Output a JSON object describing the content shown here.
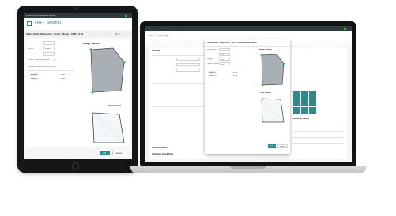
{
  "tablet": {
    "window_title": "Dynamics 365 Business Central",
    "header_title": "VRF - Setenig",
    "page_title": "Sales Order Shape Fen - Front - Rome - VSIP - 3.45",
    "section_title": "Shape Sketch",
    "section_sub": "CAD Model",
    "table_header": "Shape Dimensions and Bend",
    "fields": [
      {
        "label": "Shape No.",
        "value": "10"
      },
      {
        "label": "Width",
        "value": "3.400"
      },
      {
        "label": "Height",
        "value": "3.5"
      },
      {
        "label": "Sheet Thickness",
        "value": "3 mm"
      }
    ],
    "table_rows": [
      {
        "name": "Width 1",
        "value": "3.40"
      },
      {
        "name": "Height 1",
        "value": "3.50"
      }
    ],
    "footer_ok": "OK",
    "footer_cancel": "Cancel"
  },
  "laptop": {
    "window_title": "Dynamics 365 Business Central",
    "header_title": "VRF - Setenig",
    "dialog_title": "Sales Order Shape Dim - Sort - Order 365 Business",
    "section_title": "Shape Sketch",
    "section_sub": "CAD Model",
    "tabs": [
      "Home",
      "Prepare",
      "Print/Send",
      "Order",
      "Request Approval",
      "Navigate",
      "Actions"
    ],
    "left_section_a": "General",
    "left_section_b": "Invoice Details",
    "left_section_c": "Shipping and Billing",
    "dialog_fields": [
      {
        "label": "Shape No.",
        "value": "10"
      },
      {
        "label": "Width",
        "value": "3.4"
      },
      {
        "label": "Height",
        "value": "3.5"
      },
      {
        "label": "Sheet Thickness",
        "value": "3 mm"
      }
    ],
    "dialog_rows": [
      {
        "name": "Width 1",
        "value": "3.40"
      },
      {
        "name": "Height 1",
        "value": "3.50"
      }
    ],
    "right_title_a": "Sales Line Details",
    "right_title_b": "Customer Details",
    "footer_ok": "OK",
    "footer_cancel": "Cancel"
  },
  "colors": {
    "ui_bar": "#2d3a3e",
    "accent_teal": "#2f8a8d",
    "handle_green": "#3cb554",
    "device_black": "#151617"
  }
}
